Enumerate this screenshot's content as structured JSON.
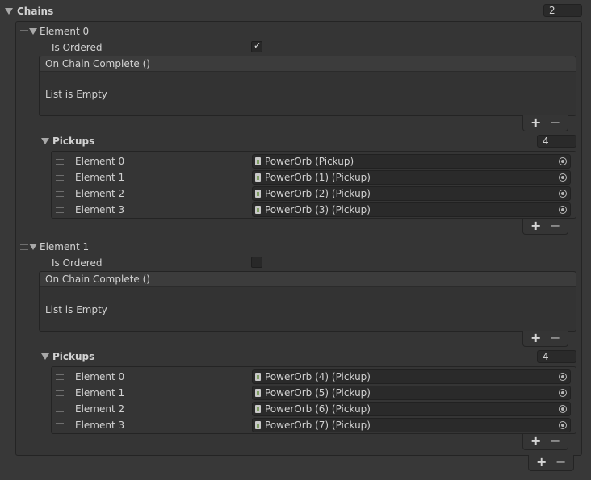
{
  "chains": {
    "label": "Chains",
    "size": "2",
    "elements": [
      {
        "label": "Element 0",
        "is_ordered_label": "Is Ordered",
        "is_ordered": true,
        "event": {
          "header": "On Chain Complete ()",
          "empty_text": "List is Empty"
        },
        "pickups": {
          "label": "Pickups",
          "size": "4",
          "items": [
            {
              "label": "Element 0",
              "value": "PowerOrb (Pickup)"
            },
            {
              "label": "Element 1",
              "value": "PowerOrb (1) (Pickup)"
            },
            {
              "label": "Element 2",
              "value": "PowerOrb (2) (Pickup)"
            },
            {
              "label": "Element 3",
              "value": "PowerOrb (3) (Pickup)"
            }
          ]
        }
      },
      {
        "label": "Element 1",
        "is_ordered_label": "Is Ordered",
        "is_ordered": false,
        "event": {
          "header": "On Chain Complete ()",
          "empty_text": "List is Empty"
        },
        "pickups": {
          "label": "Pickups",
          "size": "4",
          "items": [
            {
              "label": "Element 0",
              "value": "PowerOrb (4) (Pickup)"
            },
            {
              "label": "Element 1",
              "value": "PowerOrb (5) (Pickup)"
            },
            {
              "label": "Element 2",
              "value": "PowerOrb (6) (Pickup)"
            },
            {
              "label": "Element 3",
              "value": "PowerOrb (7) (Pickup)"
            }
          ]
        }
      }
    ]
  },
  "icons": {
    "foldout": "triangle-down-icon",
    "drag_handle": "drag-handle-icon",
    "add": "+",
    "remove": "−",
    "checkmark": "✓",
    "object_picker": "target-circle-icon",
    "script_asset": "script-file-icon"
  },
  "colors": {
    "background": "#383838",
    "field": "#2a2a2a",
    "header": "#3c3c3c",
    "text": "#d2d2d2"
  }
}
